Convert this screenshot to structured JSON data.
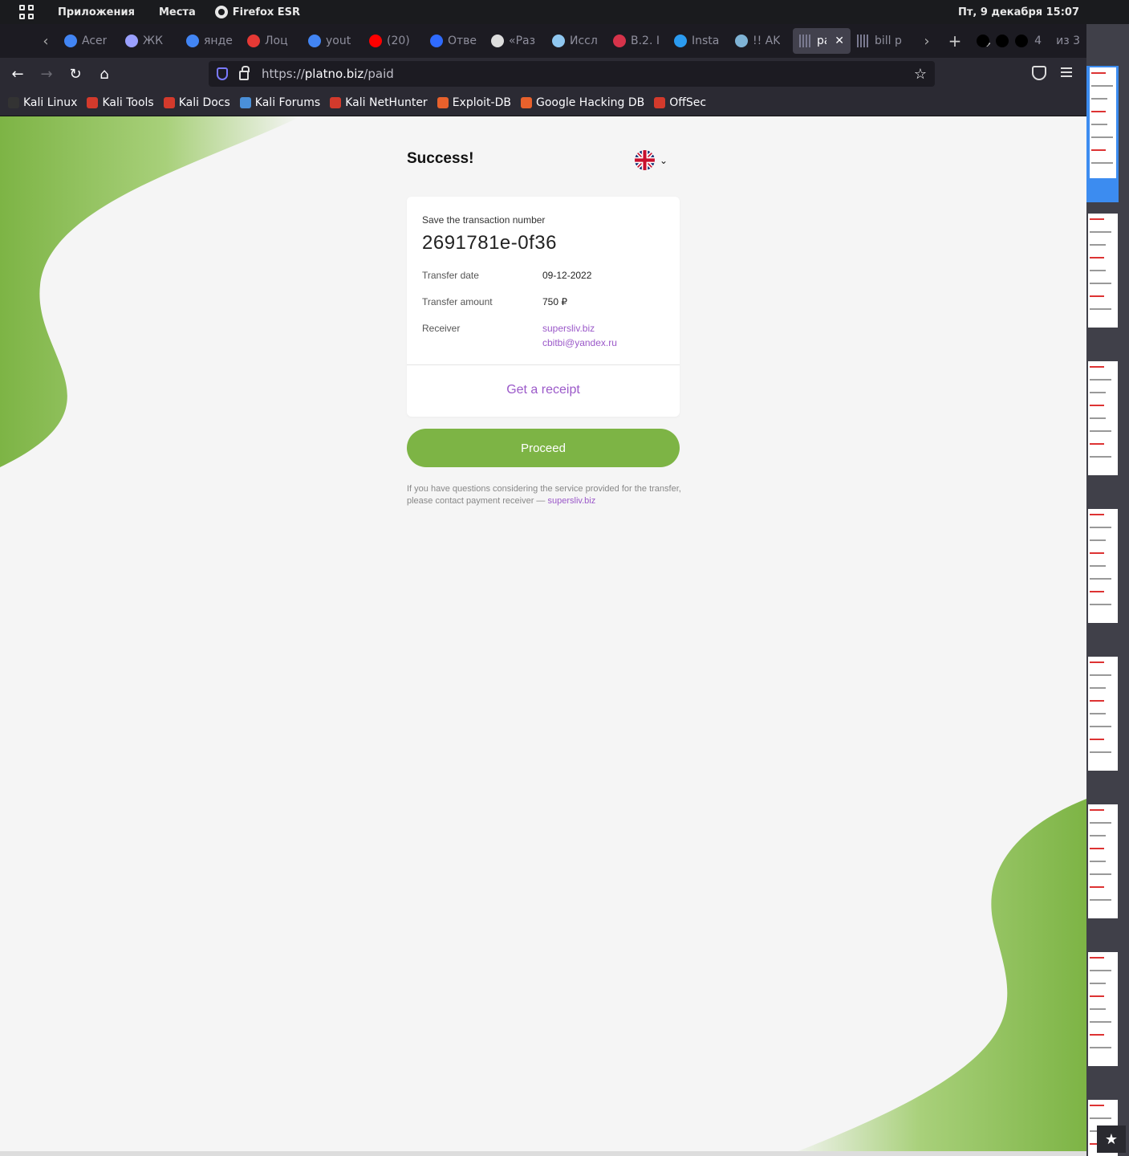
{
  "system_bar": {
    "applications": "Приложения",
    "places": "Места",
    "app_name": "Firefox ESR",
    "clock": "Пт, 9 декабря  15:07"
  },
  "tabs": [
    {
      "label": "Acer",
      "color": "#4285f4"
    },
    {
      "label": "ЖК",
      "color": "#9aa0ff"
    },
    {
      "label": "янде",
      "color": "#4285f4"
    },
    {
      "label": "Лоц",
      "color": "#e53935"
    },
    {
      "label": "yout",
      "color": "#4285f4"
    },
    {
      "label": "(20)",
      "color": "#ff0000"
    },
    {
      "label": "Отве",
      "color": "#2f6bff"
    },
    {
      "label": "«Раз",
      "color": "#dddddd"
    },
    {
      "label": "Иссл",
      "color": "#8fc7f0"
    },
    {
      "label": "B.2. I",
      "color": "#d6334a"
    },
    {
      "label": "Insta",
      "color": "#2b9bf0"
    },
    {
      "label": "!! AK",
      "color": "#7fb3d5"
    }
  ],
  "active_tab": {
    "label": "paid",
    "color": "#7a7a90"
  },
  "next_tab": {
    "label": "bill p",
    "color": "#7a7a90"
  },
  "tab_counter": "4",
  "tab_counter_suffix": "из 3",
  "url": {
    "scheme": "https://",
    "host": "platno.biz",
    "path": "/paid"
  },
  "bookmarks": [
    {
      "label": "Kali Linux",
      "color": "#333333"
    },
    {
      "label": "Kali Tools",
      "color": "#d33a2c"
    },
    {
      "label": "Kali Docs",
      "color": "#d33a2c"
    },
    {
      "label": "Kali Forums",
      "color": "#4a8fd8"
    },
    {
      "label": "Kali NetHunter",
      "color": "#d33a2c"
    },
    {
      "label": "Exploit-DB",
      "color": "#e8612c"
    },
    {
      "label": "Google Hacking DB",
      "color": "#e8612c"
    },
    {
      "label": "OffSec",
      "color": "#d33a2c"
    }
  ],
  "payment": {
    "title": "Success!",
    "save_label": "Save the transaction number",
    "transaction_number": "2691781e-0f36",
    "date_label": "Transfer date",
    "date_value": "09-12-2022",
    "amount_label": "Transfer amount",
    "amount_value": "750 ₽",
    "receiver_label": "Receiver",
    "receiver_site": "supersliv.biz",
    "receiver_email": "cbitbi@yandex.ru",
    "receipt_label": "Get a receipt",
    "proceed_label": "Proceed",
    "note_text": "If you have questions considering the service provided for the transfer, please contact payment receiver — ",
    "note_link": "supersliv.biz"
  },
  "colors": {
    "accent_green": "#7db445",
    "link_purple": "#9b59c9"
  }
}
